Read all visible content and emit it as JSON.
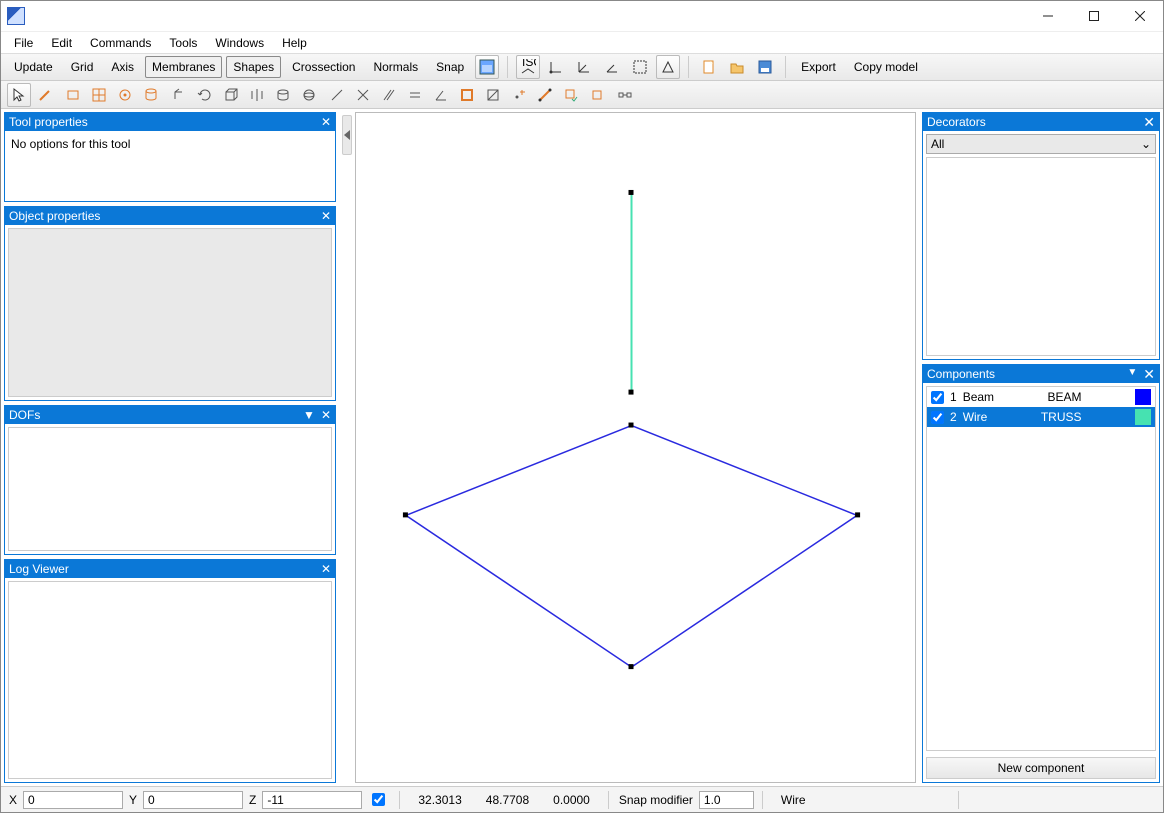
{
  "window": {
    "title": ""
  },
  "menu": {
    "file": "File",
    "edit": "Edit",
    "commands": "Commands",
    "tools": "Tools",
    "windows": "Windows",
    "help": "Help"
  },
  "tb1": {
    "update": "Update",
    "grid": "Grid",
    "axis": "Axis",
    "membranes": "Membranes",
    "shapes": "Shapes",
    "crossection": "Crossection",
    "normals": "Normals",
    "snap": "Snap",
    "export": "Export",
    "copymodel": "Copy model"
  },
  "panels": {
    "toolprops": {
      "title": "Tool properties",
      "msg": "No options for this tool"
    },
    "objprops": {
      "title": "Object properties"
    },
    "dofs": {
      "title": "DOFs"
    },
    "log": {
      "title": "Log Viewer"
    },
    "decor": {
      "title": "Decorators",
      "sel": "All"
    },
    "comps": {
      "title": "Components",
      "newbtn": "New component",
      "items": [
        {
          "idx": "1",
          "name": "Beam",
          "type": "BEAM",
          "color": "#0000ff",
          "checked": true,
          "selected": false
        },
        {
          "idx": "2",
          "name": "Wire",
          "type": "TRUSS",
          "color": "#46e2b1",
          "checked": true,
          "selected": true
        }
      ]
    }
  },
  "status": {
    "x_label": "X",
    "x_val": "0",
    "y_label": "Y",
    "y_val": "0",
    "z_label": "Z",
    "z_val": "-11",
    "check": true,
    "n1": "32.3013",
    "n2": "48.7708",
    "n3": "0.0000",
    "snapmod_label": "Snap modifier",
    "snapmod_val": "1.0",
    "comp": "Wire"
  }
}
